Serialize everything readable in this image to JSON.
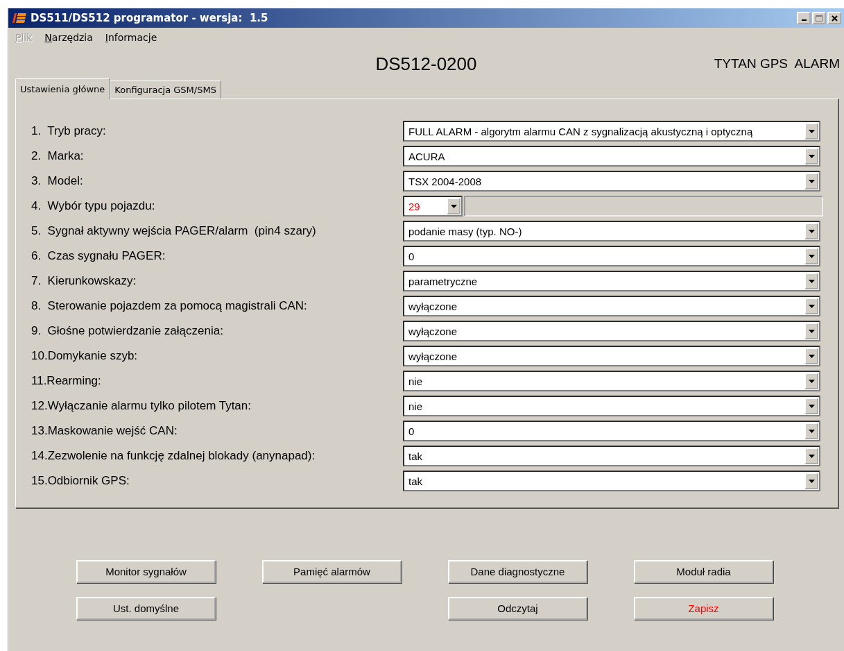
{
  "window": {
    "title": "DS511/DS512 programator - wersja:  1.5"
  },
  "menu": [
    {
      "label": "Plik",
      "disabled": true
    },
    {
      "label": "Narzędzia",
      "disabled": false
    },
    {
      "label": "Informacje",
      "disabled": false
    }
  ],
  "device": "DS512-0200",
  "device_type": "TYTAN GPS  ALARM",
  "tabs": [
    {
      "label": "Ustawienia główne",
      "selected": true
    },
    {
      "label": "Konfiguracja GSM/SMS",
      "selected": false
    }
  ],
  "settings": [
    {
      "kind": "combo",
      "label": "1.  Tryb pracy:",
      "value": "FULL ALARM - algorytm alarmu CAN z sygnalizacją akustyczną i optyczną"
    },
    {
      "kind": "combo",
      "label": "2.  Marka:",
      "value": "ACURA"
    },
    {
      "kind": "combo",
      "label": "3.  Model:",
      "value": "TSX 2004-2008"
    },
    {
      "kind": "number",
      "label": "4.  Wybór typu pojazdu:",
      "value": "29",
      "highlighted": true
    },
    {
      "kind": "combo",
      "label": "5.  Sygnał aktywny wejścia PAGER/alarm  (pin4 szary)",
      "value": "podanie masy (typ. NO-)"
    },
    {
      "kind": "combo",
      "label": "6.  Czas sygnału PAGER:",
      "value": "0"
    },
    {
      "kind": "combo",
      "label": "7.  Kierunkowskazy:",
      "value": "parametryczne"
    },
    {
      "kind": "combo",
      "label": "8.  Sterowanie pojazdem za pomocą magistrali CAN:",
      "value": "wyłączone"
    },
    {
      "kind": "combo",
      "label": "9.  Głośne potwierdzanie załączenia:",
      "value": "wyłączone"
    },
    {
      "kind": "combo",
      "label": "10.Domykanie szyb:",
      "value": "wyłączone"
    },
    {
      "kind": "combo",
      "label": "11.Rearming:",
      "value": "nie"
    },
    {
      "kind": "combo",
      "label": "12.Wyłączanie alarmu tylko pilotem Tytan:",
      "value": "nie"
    },
    {
      "kind": "combo",
      "label": "13.Maskowanie wejść CAN:",
      "value": "0"
    },
    {
      "kind": "combo",
      "label": "14.Zezwolenie na funkcję zdalnej blokady (anynapad):",
      "value": "tak"
    },
    {
      "kind": "combo",
      "label": "15.Odbiornik GPS:",
      "value": "tak"
    }
  ],
  "button_columns": [
    [
      {
        "label": "Monitor sygnałów",
        "warning": false
      },
      {
        "label": "Ust. domyślne",
        "warning": false
      }
    ],
    [
      {
        "label": "Pamięć alarmów",
        "warning": false
      }
    ],
    [
      {
        "label": "Dane diagnostyczne",
        "warning": false
      },
      {
        "label": "Odczytaj",
        "warning": false
      }
    ],
    [
      {
        "label": "Moduł radia",
        "warning": false
      },
      {
        "label": "Zapisz",
        "warning": true
      }
    ]
  ]
}
